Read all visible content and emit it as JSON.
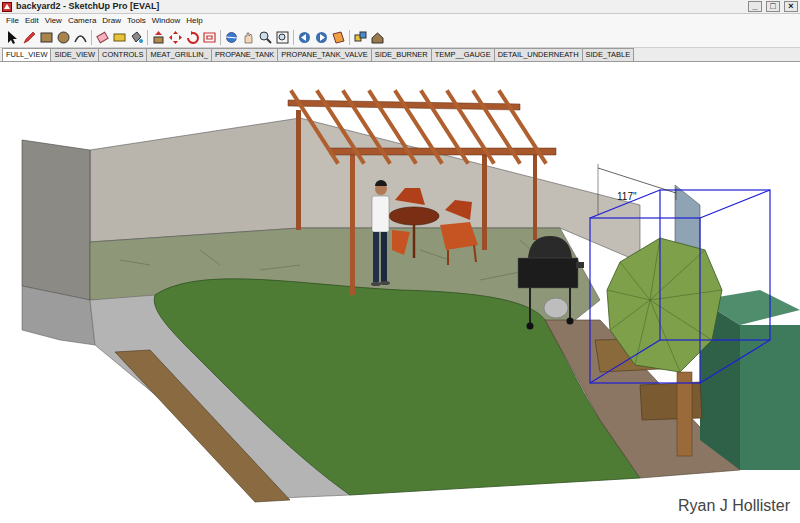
{
  "window": {
    "title": "backyard2 - SketchUp Pro [EVAL]",
    "controls": [
      "_",
      "□",
      "×"
    ]
  },
  "menu": [
    "File",
    "Edit",
    "View",
    "Camera",
    "Draw",
    "Tools",
    "Window",
    "Help"
  ],
  "scene_tabs": [
    {
      "label": "FULL_VIEW",
      "selected": true
    },
    {
      "label": "SIDE_VIEW",
      "selected": false
    },
    {
      "label": "CONTROLS",
      "selected": false
    },
    {
      "label": "MEAT_GRILLIN_",
      "selected": false
    },
    {
      "label": "PROPANE_TANK",
      "selected": false
    },
    {
      "label": "PROPANE_TANK_VALVE",
      "selected": false
    },
    {
      "label": "SIDE_BURNER",
      "selected": false
    },
    {
      "label": "TEMP__GAUGE",
      "selected": false
    },
    {
      "label": "DETAIL_UNDERNEATH",
      "selected": false
    },
    {
      "label": "SIDE_TABLE",
      "selected": false
    }
  ],
  "viewport": {
    "dimension_label": "117\""
  },
  "watermark": "Ryan J Hollister"
}
